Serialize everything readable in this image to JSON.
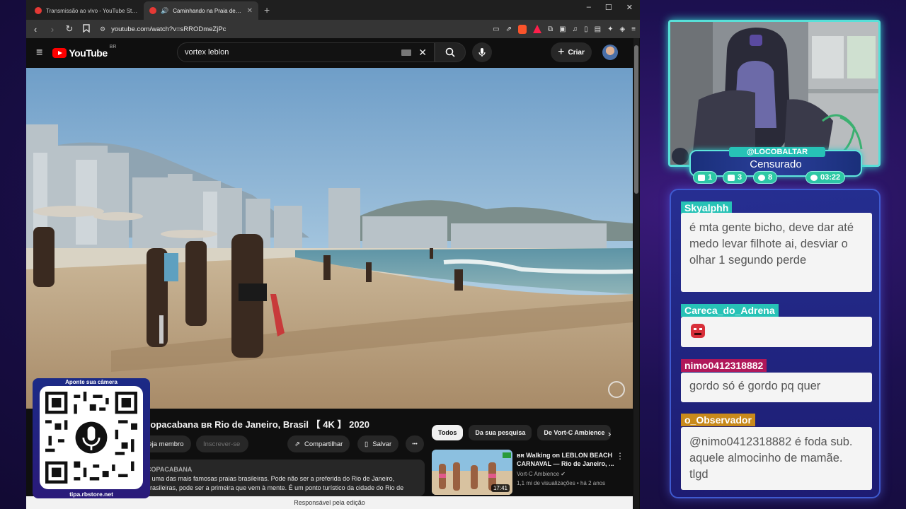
{
  "browser": {
    "tabs": [
      {
        "label": "Transmissão ao vivo - YouTube Studio",
        "active": false
      },
      {
        "label": "Caminhando na Praia de Copacabana",
        "active": true
      }
    ],
    "new_tab": "+",
    "window_controls": [
      "–",
      "☐",
      "✕"
    ],
    "url": "youtube.com/watch?v=sRRODmeZjPc"
  },
  "youtube": {
    "logo": "YouTube",
    "region": "BR",
    "search_value": "vortex leblon",
    "create_label": "Criar",
    "video_title": "Copacabana ʙʀ Rio de Janeiro, Brasil 【 4K 】 2020",
    "join_label": "Seja membro",
    "subscribe_label": "Inscrever-se",
    "share_label": "Compartilhar",
    "save_label": "Salvar",
    "more_label": "•••",
    "description": {
      "heading": "COPACABANA",
      "line1": "é uma das mais famosas praias brasileiras. Pode não ser a preferida do Rio de Janeiro,",
      "line2": "brasileiras, pode ser a primeira que vem à mente. É um ponto turístico da cidade do Rio de"
    },
    "chips": [
      {
        "label": "Todos",
        "active": true
      },
      {
        "label": "Da sua pesquisa",
        "active": false
      },
      {
        "label": "De Vort-C Ambience",
        "active": false
      }
    ],
    "recommendation": {
      "title": "ʙʀ Walking on LEBLON BEACH CARNAVAL — Rio de Janeiro, ...",
      "channel": "Vort-C Ambience",
      "stats": "1,1 mi de visualizações • há 2 anos",
      "duration": "17:41"
    },
    "footer": "Responsável pela edição"
  },
  "qr": {
    "top_text": "Aponte sua câmera",
    "bottom_text": "tipa.rbstore.net"
  },
  "stream": {
    "handle": "@LOCOBALTAR",
    "status": "Censurado",
    "stats": {
      "chat": "1",
      "youtube": "3",
      "viewers": "8",
      "time": "03:22"
    }
  },
  "chat": [
    {
      "user": "Skyalphh",
      "color": "#27c2b6",
      "text": "é mta gente bicho, deve dar até medo levar filhote ai, desviar o olhar 1 segundo perde"
    },
    {
      "user": "Careca_do_Adrena",
      "color": "#27c2b6",
      "text": ""
    },
    {
      "user": "nimo0412318882",
      "color": "#b0185a",
      "text": "gordo só é gordo pq quer"
    },
    {
      "user": "o_Observador",
      "color": "#c98a1b",
      "text": "@nimo0412318882 é foda sub. aquele almocinho de mamãe. tlgd"
    }
  ]
}
